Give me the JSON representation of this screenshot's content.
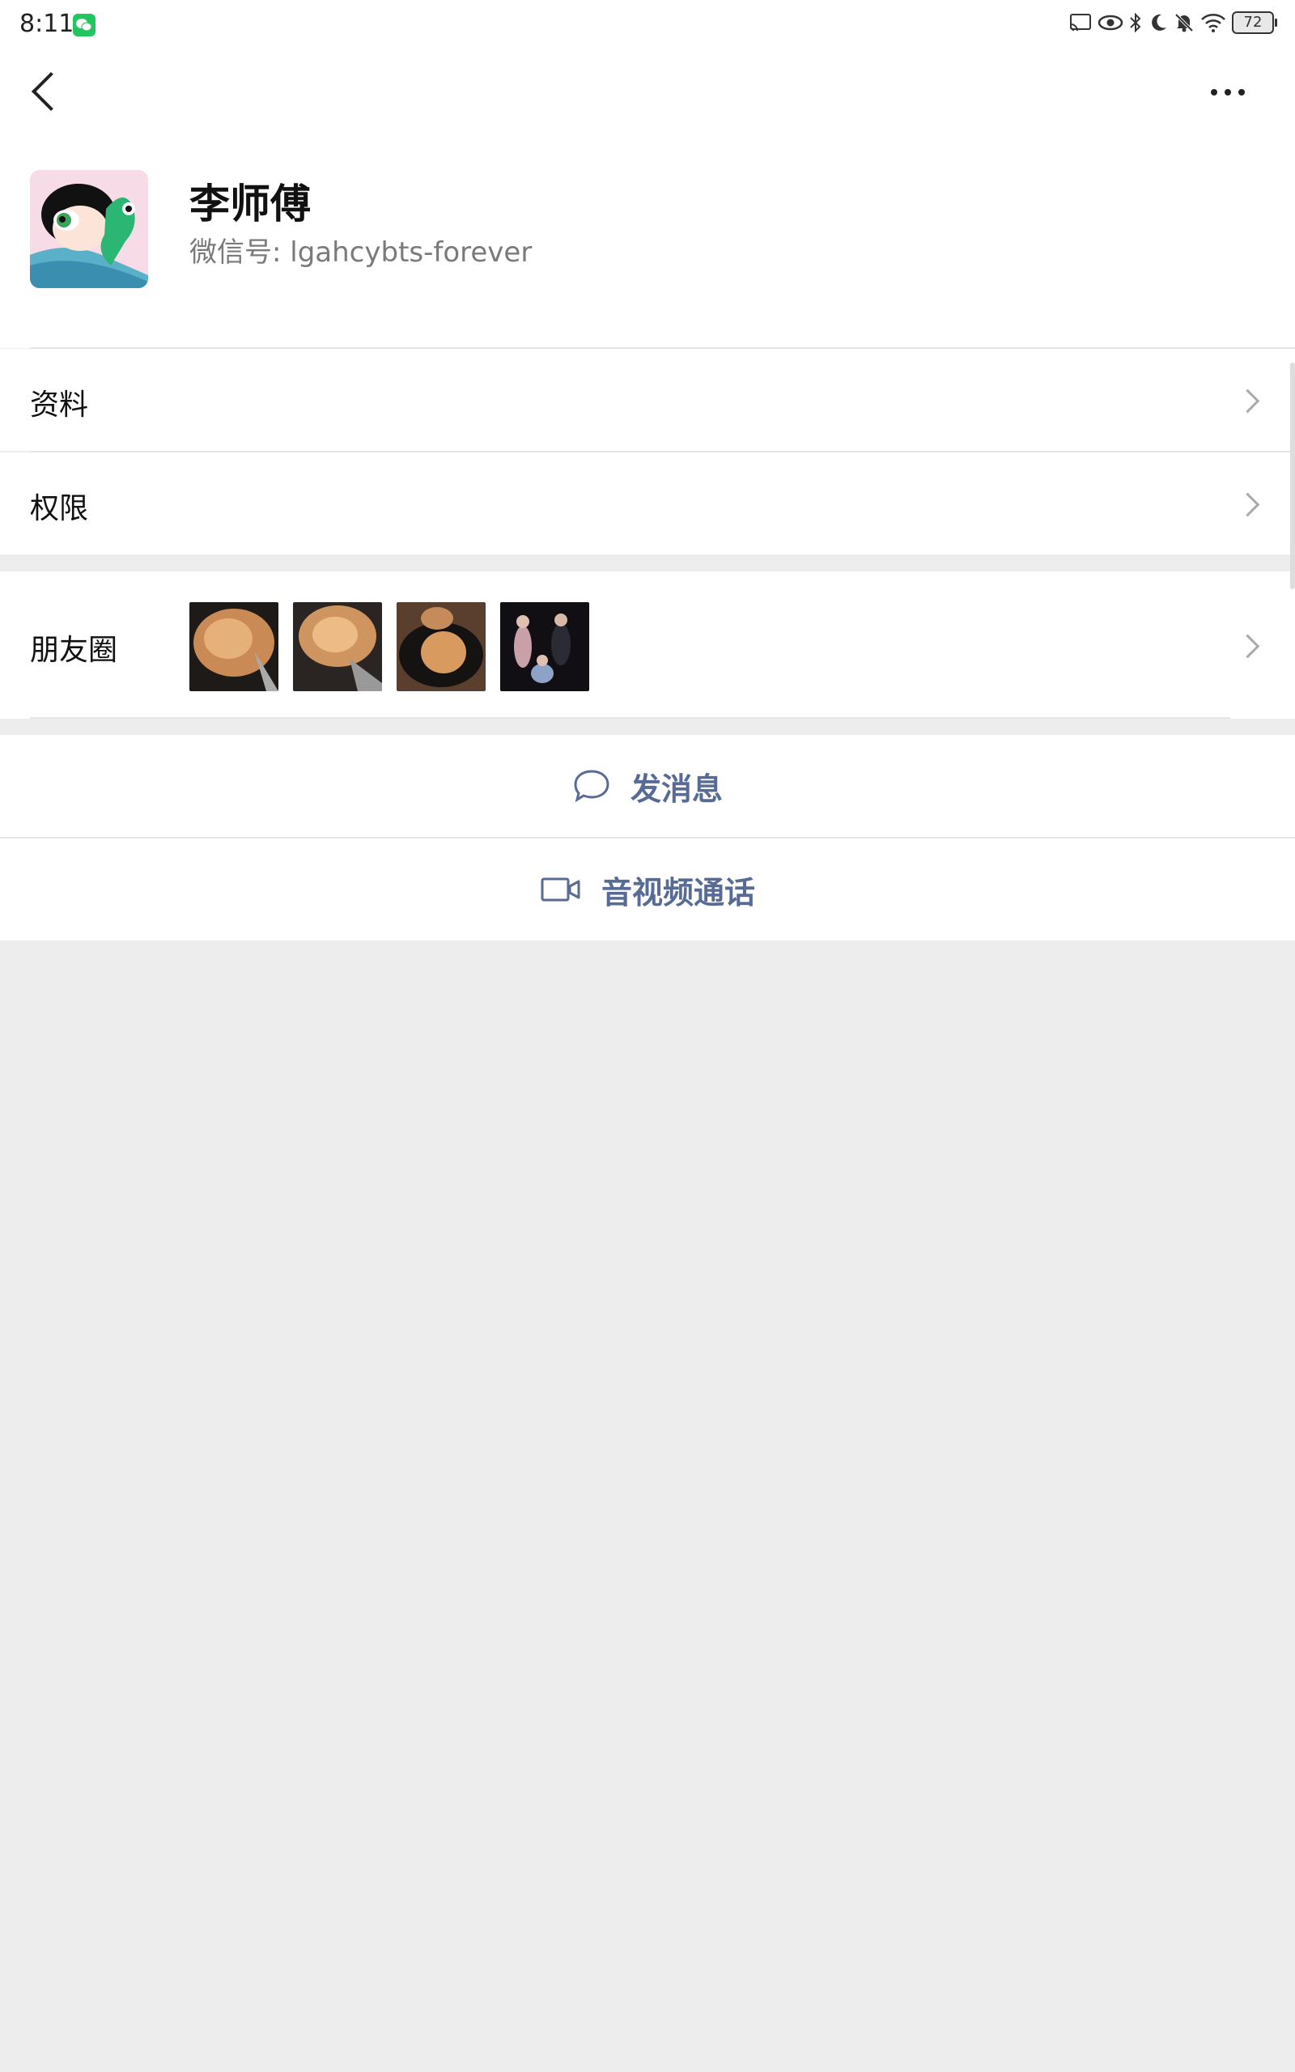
{
  "status_bar": {
    "time": "8:11",
    "battery": "72",
    "icons": [
      "cast-icon",
      "eye-icon",
      "bluetooth-icon",
      "moon-icon",
      "bell-off-icon",
      "wifi-icon",
      "battery-icon"
    ]
  },
  "nav": {
    "back_icon": "chevron-left-icon",
    "more_icon": "more-dots-icon"
  },
  "profile": {
    "name": "李师傅",
    "wechat_id": "微信号: lgahcybts-forever"
  },
  "rows": {
    "info": "资料",
    "permissions": "权限",
    "moments": "朋友圈"
  },
  "actions": {
    "message": "发消息",
    "call": "音视频通话"
  },
  "colors": {
    "accent": "#576b95",
    "background": "#ededed",
    "wechat_green": "#22c55e"
  }
}
